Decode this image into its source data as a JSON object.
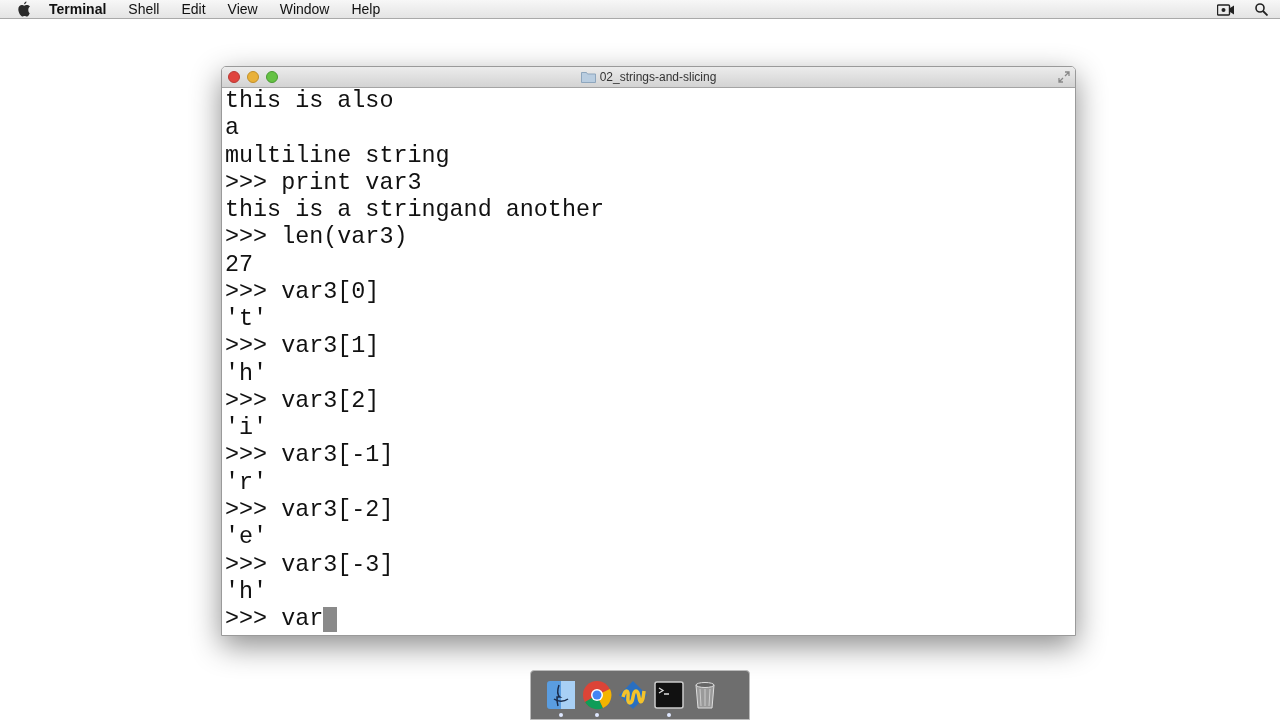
{
  "menu_bar": {
    "app": "Terminal",
    "items": [
      "Shell",
      "Edit",
      "View",
      "Window",
      "Help"
    ]
  },
  "window": {
    "title": "02_strings-and-slicing"
  },
  "terminal": {
    "lines": [
      "this is also",
      "a",
      "multiline string",
      ">>> print var3",
      "this is a stringand another",
      ">>> len(var3)",
      "27",
      ">>> var3[0]",
      "'t'",
      ">>> var3[1]",
      "'h'",
      ">>> var3[2]",
      "'i'",
      ">>> var3[-1]",
      "'r'",
      ">>> var3[-2]",
      "'e'",
      ">>> var3[-3]",
      "'h'"
    ],
    "input": ">>> var",
    "cursor": true
  },
  "dock": [
    {
      "kind": "finder",
      "running": true
    },
    {
      "kind": "chrome",
      "running": true
    },
    {
      "kind": "writer",
      "running": false
    },
    {
      "kind": "terminal",
      "running": true
    },
    {
      "kind": "trash",
      "running": false
    }
  ]
}
